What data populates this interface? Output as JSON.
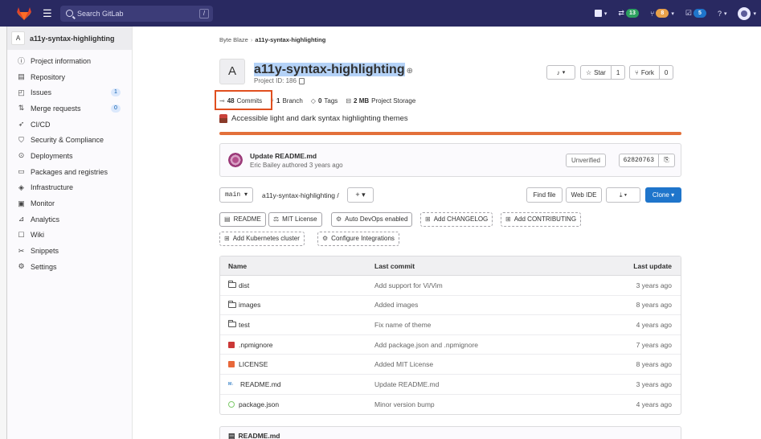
{
  "topbar": {
    "search_placeholder": "Search GitLab",
    "search_shortcut": "/",
    "mr_count": "13",
    "issues_count": "8",
    "todos_count": "5"
  },
  "sidebar": {
    "project_initial": "A",
    "project_name": "a11y-syntax-highlighting",
    "items": [
      {
        "label": "Project information",
        "icon": "info-icon"
      },
      {
        "label": "Repository",
        "icon": "book-icon"
      },
      {
        "label": "Issues",
        "icon": "issues-icon",
        "badge": "1"
      },
      {
        "label": "Merge requests",
        "icon": "merge-request-icon",
        "badge": "0"
      },
      {
        "label": "CI/CD",
        "icon": "rocket-icon"
      },
      {
        "label": "Security & Compliance",
        "icon": "shield-icon"
      },
      {
        "label": "Deployments",
        "icon": "deployments-icon"
      },
      {
        "label": "Packages and registries",
        "icon": "package-icon"
      },
      {
        "label": "Infrastructure",
        "icon": "cloud-icon"
      },
      {
        "label": "Monitor",
        "icon": "monitor-icon"
      },
      {
        "label": "Analytics",
        "icon": "chart-icon"
      },
      {
        "label": "Wiki",
        "icon": "wiki-icon"
      },
      {
        "label": "Snippets",
        "icon": "snippet-icon"
      },
      {
        "label": "Settings",
        "icon": "settings-icon"
      }
    ]
  },
  "breadcrumb": {
    "group": "Byte Blaze",
    "project": "a11y-syntax-highlighting"
  },
  "project": {
    "initial": "A",
    "title": "a11y-syntax-highlighting",
    "id_label": "Project ID: 186",
    "star_label": "Star",
    "star_count": "1",
    "fork_label": "Fork",
    "fork_count": "0",
    "description": "Accessible light and dark syntax highlighting themes"
  },
  "stats": {
    "commits_num": "48",
    "commits_label": "Commits",
    "branch_num": "1",
    "branch_label": "Branch",
    "tags_num": "0",
    "tags_label": "Tags",
    "storage_num": "2 MB",
    "storage_label": "Project Storage"
  },
  "last_commit": {
    "title": "Update README.md",
    "author_line": "Eric Bailey authored 3 years ago",
    "verification": "Unverified",
    "sha": "62820763"
  },
  "repo_nav": {
    "branch": "main",
    "path": "a11y-syntax-highlighting",
    "path_sep": "/",
    "plus": "+",
    "find_file": "Find file",
    "web_ide": "Web IDE",
    "clone": "Clone"
  },
  "chips": [
    {
      "label": "README",
      "style": "solid"
    },
    {
      "label": "MIT License",
      "style": "solid"
    },
    {
      "label": "Auto DevOps enabled",
      "style": "solid"
    },
    {
      "label": "Add CHANGELOG",
      "style": "dashed"
    },
    {
      "label": "Add CONTRIBUTING",
      "style": "dashed"
    },
    {
      "label": "Add Kubernetes cluster",
      "style": "dashed"
    },
    {
      "label": "Configure Integrations",
      "style": "dashed"
    }
  ],
  "files": {
    "headers": {
      "name": "Name",
      "commit": "Last commit",
      "date": "Last update"
    },
    "rows": [
      {
        "name": "dist",
        "type": "folder",
        "commit": "Add support for Vi/Vim",
        "date": "3 years ago"
      },
      {
        "name": "images",
        "type": "folder",
        "commit": "Added images",
        "date": "8 years ago"
      },
      {
        "name": "test",
        "type": "folder",
        "commit": "Fix name of theme",
        "date": "4 years ago"
      },
      {
        "name": ".npmignore",
        "type": "npm",
        "commit": "Add package.json and .npmignore",
        "date": "7 years ago"
      },
      {
        "name": "LICENSE",
        "type": "license",
        "commit": "Added MIT License",
        "date": "8 years ago"
      },
      {
        "name": "README.md",
        "type": "markdown",
        "commit": "Update README.md",
        "date": "3 years ago"
      },
      {
        "name": "package.json",
        "type": "json",
        "commit": "Minor version bump",
        "date": "4 years ago"
      }
    ]
  },
  "readme_header": "README.md",
  "colors": {
    "accent": "#1f75cb",
    "topbar": "#292961",
    "highlight_box": "#e04f1f",
    "language_bar": "#e3703a"
  }
}
